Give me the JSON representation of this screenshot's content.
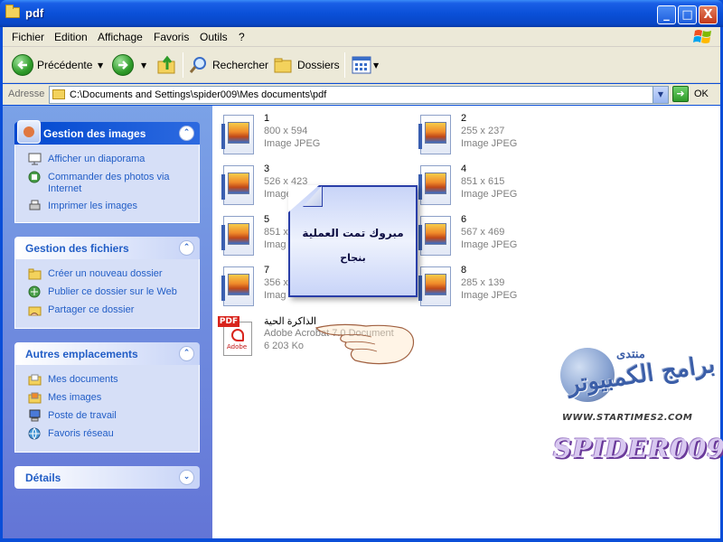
{
  "window": {
    "title": "pdf",
    "controls": {
      "minimize": "_",
      "maximize": "□",
      "close": "X"
    }
  },
  "menu": [
    "Fichier",
    "Edition",
    "Affichage",
    "Favoris",
    "Outils",
    "?"
  ],
  "toolbar": {
    "back": "Précédente",
    "search": "Rechercher",
    "folders": "Dossiers"
  },
  "address": {
    "label": "Adresse",
    "path": "C:\\Documents and Settings\\spider009\\Mes documents\\pdf",
    "go": "OK"
  },
  "sidebar": {
    "images": {
      "title": "Gestion des images",
      "items": [
        "Afficher un diaporama",
        "Commander des photos via Internet",
        "Imprimer les images"
      ]
    },
    "files": {
      "title": "Gestion des fichiers",
      "items": [
        "Créer un nouveau dossier",
        "Publier ce dossier sur le Web",
        "Partager ce dossier"
      ]
    },
    "places": {
      "title": "Autres emplacements",
      "items": [
        "Mes documents",
        "Mes images",
        "Poste de travail",
        "Favoris réseau"
      ]
    },
    "details": {
      "title": "Détails"
    }
  },
  "files": [
    {
      "name": "1",
      "dims": "800 x 594",
      "type": "Image JPEG"
    },
    {
      "name": "2",
      "dims": "255 x 237",
      "type": "Image JPEG"
    },
    {
      "name": "3",
      "dims": "526 x 423",
      "type": "Image JPEG"
    },
    {
      "name": "4",
      "dims": "851 x 615",
      "type": "Image JPEG"
    },
    {
      "name": "5",
      "dims": "851 x",
      "type": "Imag"
    },
    {
      "name": "6",
      "dims": "567 x 469",
      "type": "Image JPEG"
    },
    {
      "name": "7",
      "dims": "356 x",
      "type": "Imag"
    },
    {
      "name": "8",
      "dims": "285 x 139",
      "type": "Image JPEG"
    }
  ],
  "pdf_file": {
    "name": "الذاكرة الحية",
    "type": "Adobe Acrobat 7.0 Document",
    "size": "6 203 Ko",
    "badge": "PDF",
    "brand": "Adobe"
  },
  "message": {
    "line1": "مبروك تمت العملية",
    "line2": "بنجاح"
  },
  "watermark": {
    "arabic": "برامج الكمبيوتر",
    "small": "منتدى",
    "url": "WWW.STARTIMES2.COM",
    "name": "SPIDER009"
  }
}
